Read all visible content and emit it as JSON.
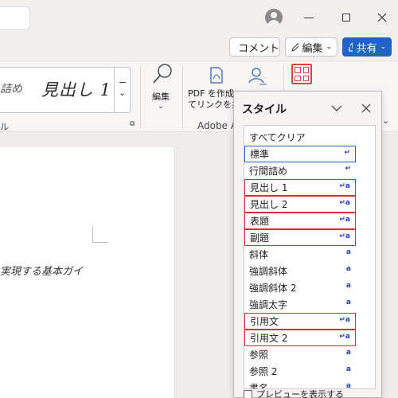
{
  "titlebar": {
    "avatar_icon": "user-avatar-icon"
  },
  "actions": {
    "comment_label": "コメント",
    "edit_label": "編集",
    "share_label": "共有"
  },
  "ribbon": {
    "gallery": {
      "item_partial": "詰め",
      "heading_label": "見出し 1"
    },
    "styles_group_label": "ル",
    "edit_label": "編集",
    "pdf_line1": "PDF を作成",
    "pdf_line2": "てリンクを共有",
    "adobe_label": "Adobe A"
  },
  "document": {
    "text_fragment": "実現する基本ガイ"
  },
  "styles_pane": {
    "title": "スタイル",
    "items": [
      {
        "label": "すべてクリア",
        "mark": ""
      },
      {
        "label": "標準",
        "mark": "↵"
      },
      {
        "label": "行間詰め",
        "mark": "↵"
      },
      {
        "label": "見出し 1",
        "mark": "↵a"
      },
      {
        "label": "見出し 2",
        "mark": "↵a"
      },
      {
        "label": "表題",
        "mark": "↵a"
      },
      {
        "label": "副題",
        "mark": "↵a"
      },
      {
        "label": "斜体",
        "mark": "a"
      },
      {
        "label": "強調斜体",
        "mark": "a"
      },
      {
        "label": "強調斜体 2",
        "mark": "a"
      },
      {
        "label": "強調太字",
        "mark": "a"
      },
      {
        "label": "引用文",
        "mark": "↵a"
      },
      {
        "label": "引用文 2",
        "mark": "↵a"
      },
      {
        "label": "参照",
        "mark": "a"
      },
      {
        "label": "参照 2",
        "mark": "a"
      },
      {
        "label": "書名",
        "mark": "a"
      }
    ],
    "preview_label": "プレビューを表示する"
  },
  "colors": {
    "share_blue": "#1f63c9",
    "highlight_red": "#cf3434",
    "selected_blue": "#2b63c7",
    "styles_icon_red": "#d24a3d"
  }
}
